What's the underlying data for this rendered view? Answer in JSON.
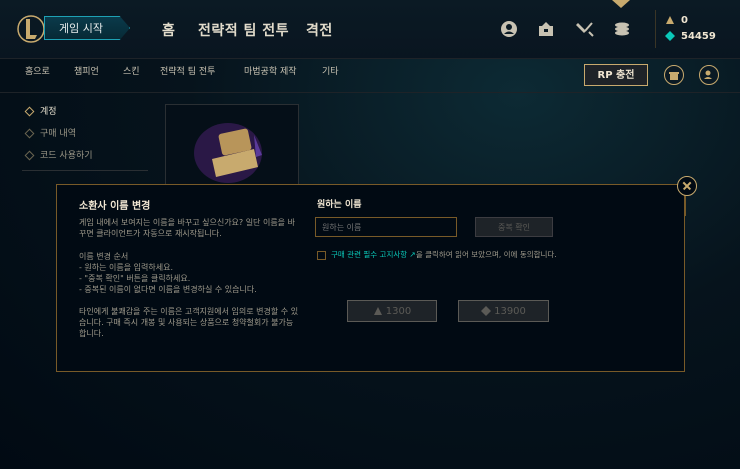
{
  "topbar": {
    "play_button": "게임 시작",
    "nav": [
      "홈",
      "전략적 팀 전투",
      "격전"
    ],
    "icons": [
      "profile-icon",
      "collection-icon",
      "loot-icon",
      "store-icon"
    ],
    "currency": {
      "rp": "0",
      "blue_essence": "54459"
    }
  },
  "subnav": {
    "items": [
      "홈으로",
      "챔피언",
      "스킨",
      "전략적 팀 전투",
      "마법공학 제작",
      "기타"
    ],
    "rp_button": "RP 충전"
  },
  "sidebar": {
    "items": [
      {
        "label": "계정",
        "active": true
      },
      {
        "label": "구매 내역",
        "active": false
      },
      {
        "label": "코드 사용하기",
        "active": false
      }
    ]
  },
  "modal": {
    "title": "소환사 이름 변경",
    "intro": "게임 내에서 보여지는 이름을 바꾸고 싶으신가요? 일단 이름을 바꾸면 클라이언트가 자동으로 재시작됩니다.",
    "steps_title": "이름 변경 순서",
    "steps": [
      "- 원하는 이름을 입력하세요.",
      "- \"중복 확인\" 버튼을 클릭하세요.",
      "- 중복된 이름이 없다면 이름을 변경하실 수 있습니다."
    ],
    "warning": "타인에게 불쾌감을 주는 이름은 고객지원에서 임의로 변경할 수 있습니다. 구매 즉시 개봉 및 사용되는 상품으로 청약철회가 불가능합니다.",
    "right_label": "원하는 이름",
    "input_placeholder": "원하는 이름",
    "check_button": "중복 확인",
    "agree_link": "구매 관련 필수 고지사항 ↗",
    "agree_text": "을 클릭하여 읽어 보았으며, 이에 동의합니다.",
    "price_rp": "1300",
    "price_be": "13900"
  }
}
